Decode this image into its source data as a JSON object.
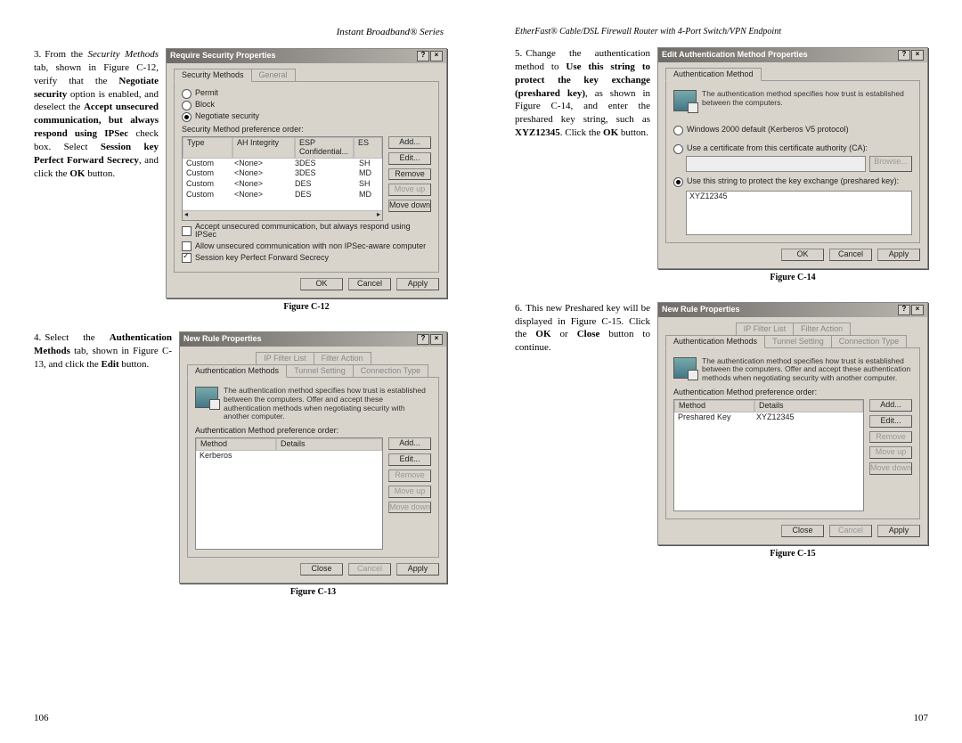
{
  "headers": {
    "left": "Instant Broadband® Series",
    "right": "EtherFast® Cable/DSL Firewall Router with 4-Port Switch/VPN Endpoint"
  },
  "page_numbers": {
    "left": "106",
    "right": "107"
  },
  "step3": {
    "num": "3.",
    "t1": "From the ",
    "t2_i": "Security Methods",
    "t3": " tab, shown in Figure C-12, verify that the ",
    "t4_b": "Negotiate security",
    "t5": " option is enabled, and deselect the ",
    "t6_b": "Accept unsecured communication, but always respond using IPSec",
    "t7": " check box. Select ",
    "t8_b": "Session key Perfect Forward Secrecy",
    "t9": ", and click the ",
    "t10_b": "OK",
    "t11": " button."
  },
  "step4": {
    "num": "4.",
    "t1": "Select the ",
    "t2_b": "Authentication Methods",
    "t3": " tab, shown in Figure C-13, and click the ",
    "t4_b": "Edit",
    "t5": " button."
  },
  "step5": {
    "num": "5.",
    "t1": "Change the authentication method to ",
    "t2_b": "Use this string to protect the key exchange (preshared key)",
    "t3": ", as shown in Figure C-14, and enter the preshared key string, such as ",
    "t4_b": "XYZ12345",
    "t5": ". Click the ",
    "t6_b": "OK",
    "t7": " button."
  },
  "step6": {
    "num": "6.",
    "t1": "This new Preshared key will be displayed in Figure C-15. Click the ",
    "t2_b": "OK",
    "t3": " or ",
    "t4_b": "Close",
    "t5": " button to continue."
  },
  "captions": {
    "c12": "Figure C-12",
    "c13": "Figure C-13",
    "c14": "Figure C-14",
    "c15": "Figure C-15"
  },
  "dlg12": {
    "title": "Require Security Properties",
    "tab1": "Security Methods",
    "tab2": "General",
    "r_permit": "Permit",
    "r_block": "Block",
    "r_neg": "Negotiate security",
    "pref_label": "Security Method preference order:",
    "cols": {
      "c1": "Type",
      "c2": "AH Integrity",
      "c3": "ESP Confidential...",
      "c4": "ES"
    },
    "rows": [
      {
        "c1": "Custom",
        "c2": "<None>",
        "c3": "3DES",
        "c4": "SH"
      },
      {
        "c1": "Custom",
        "c2": "<None>",
        "c3": "3DES",
        "c4": "MD"
      },
      {
        "c1": "Custom",
        "c2": "<None>",
        "c3": "DES",
        "c4": "SH"
      },
      {
        "c1": "Custom",
        "c2": "<None>",
        "c3": "DES",
        "c4": "MD"
      }
    ],
    "btn_add": "Add...",
    "btn_edit": "Edit...",
    "btn_remove": "Remove",
    "btn_up": "Move up",
    "btn_down": "Move down",
    "chk1": "Accept unsecured communication, but always respond using IPSec",
    "chk2": "Allow unsecured communication with non IPSec-aware computer",
    "chk3": "Session key Perfect Forward Secrecy",
    "ok": "OK",
    "cancel": "Cancel",
    "apply": "Apply"
  },
  "dlg13": {
    "title": "New Rule Properties",
    "tab_ip": "IP Filter List",
    "tab_fa": "Filter Action",
    "tab_auth": "Authentication Methods",
    "tab_tun": "Tunnel Setting",
    "tab_ct": "Connection Type",
    "info": "The authentication method specifies how trust is established between the computers. Offer and accept these authentication methods when negotiating security with another computer.",
    "pref": "Authentication Method preference order:",
    "col_m": "Method",
    "col_d": "Details",
    "row1": "Kerberos",
    "btn_add": "Add...",
    "btn_edit": "Edit...",
    "btn_remove": "Remove",
    "btn_up": "Move up",
    "btn_down": "Move down",
    "close": "Close",
    "cancel": "Cancel",
    "apply": "Apply"
  },
  "dlg14": {
    "title": "Edit Authentication Method Properties",
    "tab": "Authentication Method",
    "info": "The authentication method specifies how trust is established between the computers.",
    "r1": "Windows 2000 default (Kerberos V5 protocol)",
    "r2": "Use a certificate from this certificate authority (CA):",
    "browse": "Browse...",
    "r3": "Use this string to protect the key exchange (preshared key):",
    "key": "XYZ12345",
    "ok": "OK",
    "cancel": "Cancel",
    "apply": "Apply"
  },
  "dlg15": {
    "title": "New Rule Properties",
    "tab_ip": "IP Filter List",
    "tab_fa": "Filter Action",
    "tab_auth": "Authentication Methods",
    "tab_tun": "Tunnel Setting",
    "tab_ct": "Connection Type",
    "info": "The authentication method specifies how trust is established between the computers. Offer and accept these authentication methods when negotiating security with another computer.",
    "pref": "Authentication Method preference order:",
    "col_m": "Method",
    "col_d": "Details",
    "row_m": "Preshared Key",
    "row_d": "XYZ12345",
    "btn_add": "Add...",
    "btn_edit": "Edit...",
    "btn_remove": "Remove",
    "btn_up": "Move up",
    "btn_down": "Move down",
    "close": "Close",
    "cancel": "Cancel",
    "apply": "Apply"
  }
}
